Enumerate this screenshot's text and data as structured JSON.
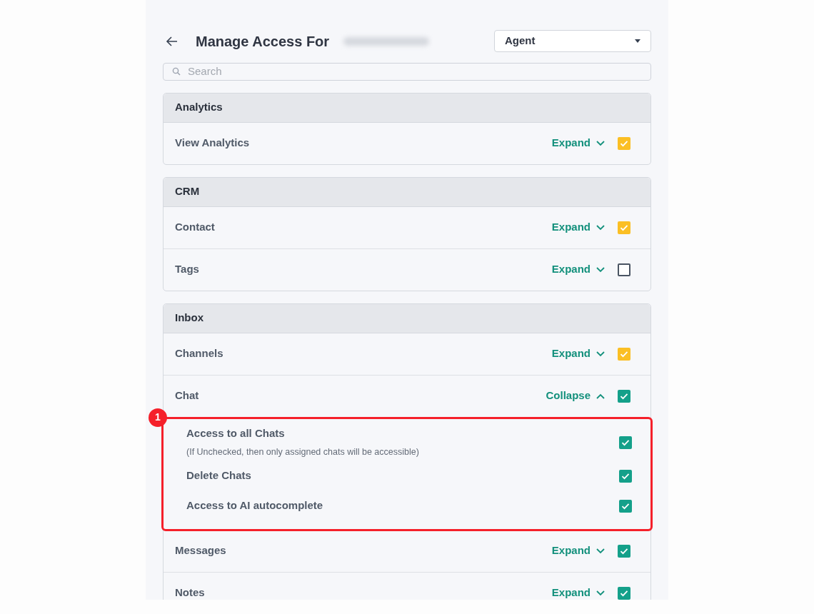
{
  "header": {
    "title": "Manage Access For",
    "role_select": {
      "value": "Agent"
    }
  },
  "search": {
    "placeholder": "Search"
  },
  "sections": [
    {
      "title": "Analytics",
      "items": [
        {
          "label": "View Analytics",
          "toggle": "Expand",
          "expanded": false,
          "checked": true,
          "partial": true
        }
      ]
    },
    {
      "title": "CRM",
      "items": [
        {
          "label": "Contact",
          "toggle": "Expand",
          "expanded": false,
          "checked": true,
          "partial": true
        },
        {
          "label": "Tags",
          "toggle": "Expand",
          "expanded": false,
          "checked": false,
          "partial": false
        }
      ]
    },
    {
      "title": "Inbox",
      "items": [
        {
          "label": "Channels",
          "toggle": "Expand",
          "expanded": false,
          "checked": true,
          "partial": true
        },
        {
          "label": "Chat",
          "toggle": "Collapse",
          "expanded": true,
          "checked": true,
          "partial": false,
          "callout": "1",
          "children": [
            {
              "label": "Access to all Chats",
              "note": "(If Unchecked, then only assigned chats will be accessible)",
              "checked": true
            },
            {
              "label": "Delete Chats",
              "checked": true
            },
            {
              "label": "Access to AI autocomplete",
              "checked": true
            }
          ]
        },
        {
          "label": "Messages",
          "toggle": "Expand",
          "expanded": false,
          "checked": true,
          "partial": false
        },
        {
          "label": "Notes",
          "toggle": "Expand",
          "expanded": false,
          "checked": true,
          "partial": false
        }
      ]
    }
  ]
}
